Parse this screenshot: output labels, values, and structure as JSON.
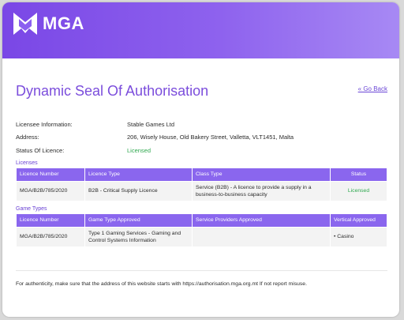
{
  "brand": {
    "name": "MGA",
    "accent": "#7b4ddc",
    "header_gradient": [
      "#7a47e6",
      "#a789f4"
    ]
  },
  "page": {
    "title": "Dynamic Seal Of Authorisation",
    "go_back": "« Go Back"
  },
  "info": [
    {
      "label": "Licensee Information:",
      "value": "Stable Games Ltd"
    },
    {
      "label": "Address:",
      "value": "206, Wisely House, Old Bakery Street, Valletta, VLT1451, Malta"
    },
    {
      "label": "Status Of Licence:",
      "value": "Licensed",
      "color": "#2fa84f"
    }
  ],
  "licenses": {
    "section": "Licenses",
    "headers": [
      "Licence Number",
      "Licence Type",
      "Class Type",
      "Status"
    ],
    "rows": [
      [
        "MGA/B2B/785/2020",
        "B2B - Critical Supply Licence",
        "Service (B2B) - A licence to provide a supply in a business-to-business capacity",
        "Licensed"
      ]
    ]
  },
  "game_types": {
    "section": "Game Types",
    "headers": [
      "Licence Number",
      "Game Type Approved",
      "Service Providers Approved",
      "Vertical Approved"
    ],
    "rows": [
      [
        "MGA/B2B/785/2020",
        "Type 1 Gaming Services - Gaming and Control Systems Information",
        "",
        "• Casino"
      ]
    ]
  },
  "footer": "For authenticity, make sure that the address of this website starts with https://authorisation.mga.org.mt If not report misuse."
}
